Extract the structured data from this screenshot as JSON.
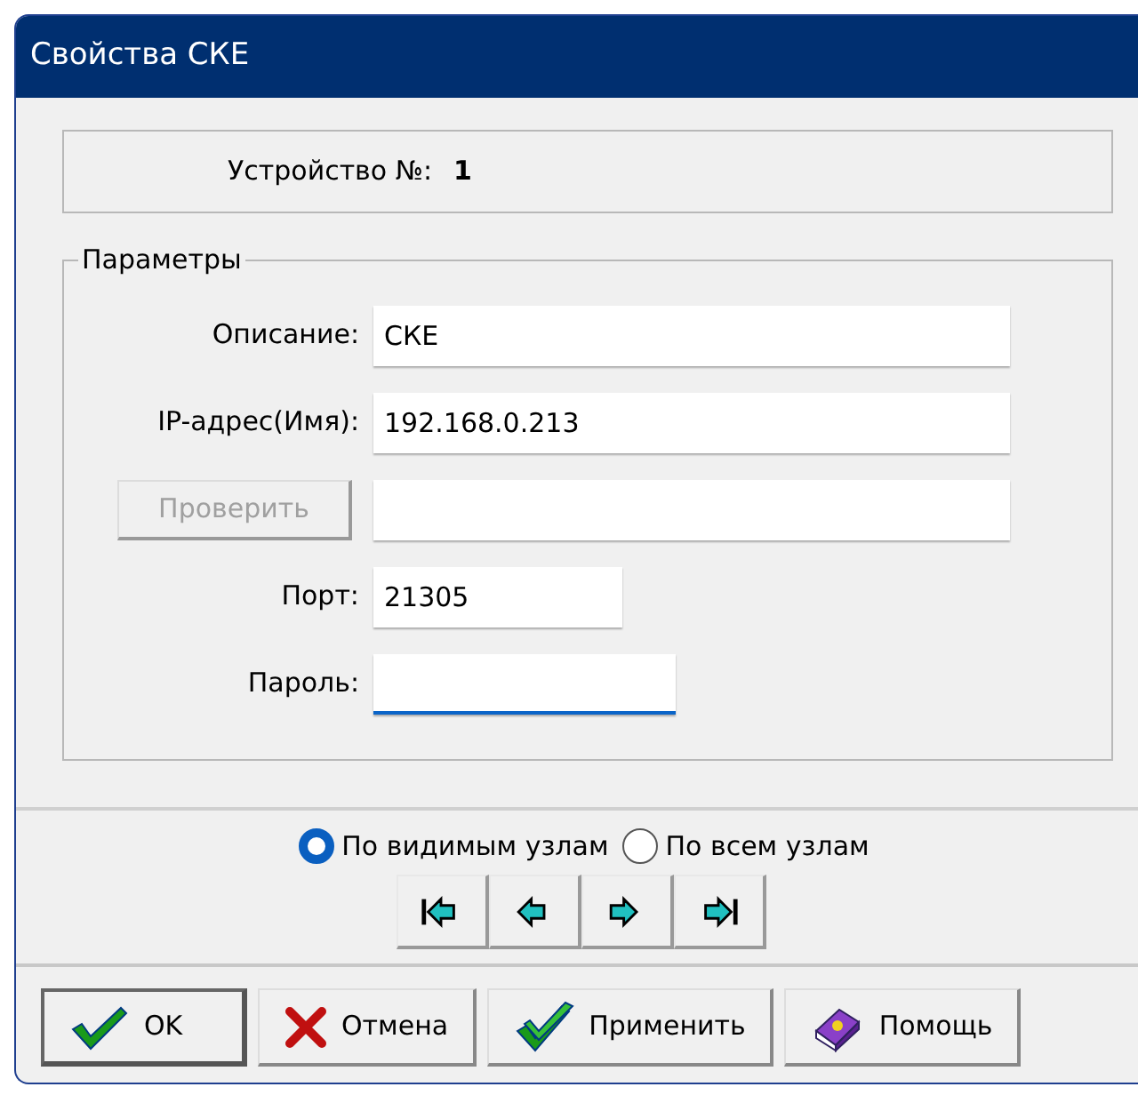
{
  "window": {
    "title": "Свойства СКЕ"
  },
  "device": {
    "label": "Устройство №:",
    "value": "1"
  },
  "parameters": {
    "title": "Параметры",
    "rows": [
      {
        "kind": "text",
        "label": "Описание:",
        "value": "СКЕ",
        "focused": false
      },
      {
        "kind": "text",
        "label": "IP-адрес(Имя):",
        "value": "192.168.0.213",
        "focused": false
      },
      {
        "kind": "button-field",
        "button": "Проверить",
        "disabled": true,
        "focused": false
      },
      {
        "kind": "number",
        "label": "Порт:",
        "value": "21305",
        "focused": false
      },
      {
        "kind": "password",
        "label": "Пароль:",
        "focused": true
      }
    ]
  },
  "mode": [
    {
      "label": "По видимым узлам",
      "selected": true
    },
    {
      "label": "По всем узлам",
      "selected": false
    }
  ],
  "nav_buttons": [
    {
      "kind": "first"
    },
    {
      "kind": "prev"
    },
    {
      "kind": "next"
    },
    {
      "kind": "last"
    }
  ],
  "buttons": [
    {
      "kind": "ok",
      "label": "OK"
    },
    {
      "kind": "cancel",
      "label": "Отмена"
    },
    {
      "kind": "apply",
      "label": "Применить"
    },
    {
      "kind": "help",
      "label": "Помощь"
    }
  ]
}
